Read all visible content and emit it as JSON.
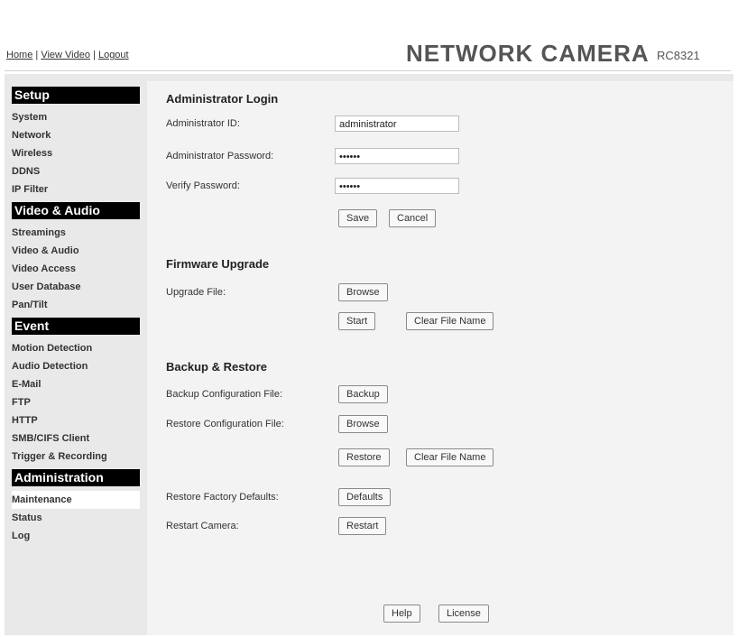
{
  "header": {
    "links": [
      {
        "label": "Home"
      },
      {
        "label": "View Video"
      },
      {
        "label": "Logout"
      }
    ],
    "separator": " | ",
    "brand": "NETWORK CAMERA",
    "model": "RC8321"
  },
  "sidebar": {
    "sections": [
      {
        "title": "Setup",
        "items": [
          "System",
          "Network",
          "Wireless",
          "DDNS",
          "IP Filter"
        ]
      },
      {
        "title": "Video & Audio",
        "items": [
          "Streamings",
          "Video & Audio",
          "Video Access",
          "User Database",
          "Pan/Tilt"
        ]
      },
      {
        "title": "Event",
        "items": [
          "Motion Detection",
          "Audio Detection",
          "E-Mail",
          "FTP",
          "HTTP",
          "SMB/CIFS Client",
          "Trigger & Recording"
        ]
      },
      {
        "title": "Administration",
        "items": [
          "Maintenance",
          "Status",
          "Log"
        ]
      }
    ],
    "active_item": "Maintenance"
  },
  "admin_login": {
    "title": "Administrator Login",
    "id_label": "Administrator ID:",
    "id_value": "administrator",
    "password_label": "Administrator Password:",
    "password_value": "••••••",
    "verify_label": "Verify Password:",
    "verify_value": "••••••",
    "save": "Save",
    "cancel": "Cancel"
  },
  "firmware": {
    "title": "Firmware Upgrade",
    "file_label": "Upgrade File:",
    "browse": "Browse",
    "start": "Start",
    "clear": "Clear File Name"
  },
  "backup": {
    "title": "Backup & Restore",
    "backup_label": "Backup Configuration File:",
    "backup_btn": "Backup",
    "restore_label": "Restore Configuration File:",
    "browse": "Browse",
    "restore_btn": "Restore",
    "clear": "Clear File Name",
    "defaults_label": "Restore Factory Defaults:",
    "defaults_btn": "Defaults",
    "restart_label": "Restart Camera:",
    "restart_btn": "Restart"
  },
  "footer": {
    "help": "Help",
    "license": "License"
  }
}
